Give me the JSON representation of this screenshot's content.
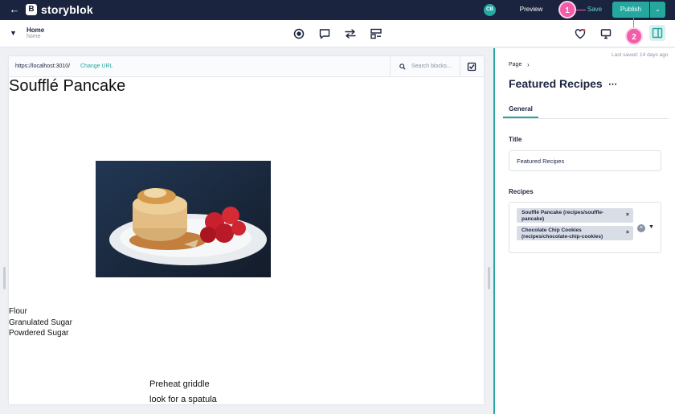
{
  "app": {
    "brand": "storyblok",
    "logo_letter": "B",
    "user_initials": "CB"
  },
  "topbar": {
    "preview_label": "Preview",
    "save_label": "Save",
    "publish_label": "Publish"
  },
  "callouts": [
    "1",
    "2"
  ],
  "story": {
    "title": "Home",
    "slug": "home"
  },
  "canvas": {
    "url": "https://localhost:3010/",
    "change_url_label": "Change URL",
    "search_placeholder": "Search blocks...",
    "heading": "Soufflé Pancake",
    "ingredients": [
      "Flour",
      "Granulated Sugar",
      "Powdered Sugar"
    ],
    "steps": [
      "Preheat griddle",
      "look for a spatula"
    ]
  },
  "panel": {
    "last_saved": "Last saved: 14 days ago",
    "breadcrumb": "Page",
    "title": "Featured Recipes",
    "tab_general": "General",
    "title_field_label": "Title",
    "title_field_value": "Featured Recipes",
    "recipes_field_label": "Recipes",
    "recipes": [
      {
        "label": "Soufflé Pancake (recipes/souffle-pancake)"
      },
      {
        "label": "Chocolate Chip Cookies (recipes/chocolate-chip-cookies)"
      }
    ]
  },
  "colors": {
    "topbar": "#1b243f",
    "accent": "#23a79f",
    "callout": "#f25ca8"
  }
}
